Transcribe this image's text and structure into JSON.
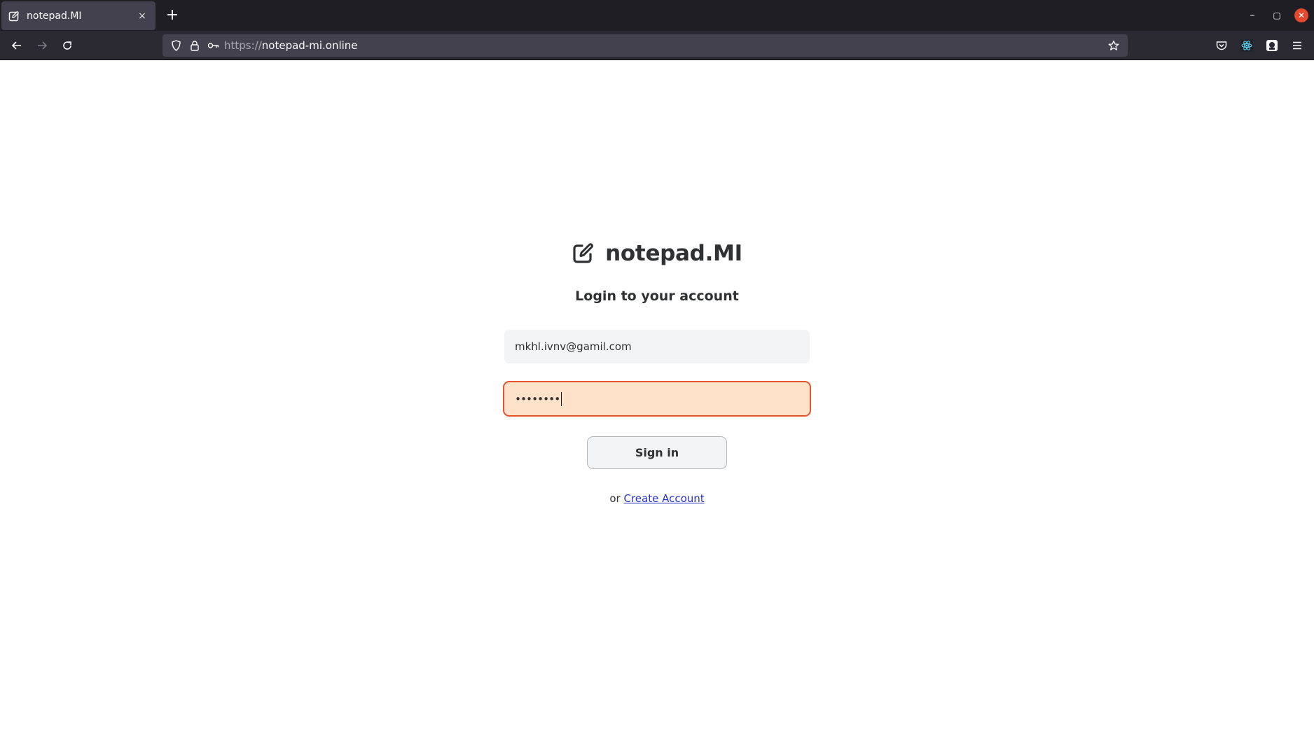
{
  "browser": {
    "tab": {
      "title": "notepad.MI",
      "close_glyph": "×"
    },
    "new_tab_glyph": "+",
    "window_controls": {
      "minimize": "–",
      "maximize": "▢",
      "close": "✕"
    },
    "url": {
      "scheme": "https://",
      "host": "notepad-mi.online"
    },
    "icons": [
      "back-icon",
      "forward-icon",
      "reload-icon",
      "shield-icon",
      "lock-icon",
      "key-icon",
      "star-icon",
      "pocket-icon",
      "react-devtools-icon",
      "extension-icon",
      "menu-icon"
    ]
  },
  "login": {
    "brand_name": "notepad.MI",
    "subtitle": "Login to your account",
    "email_value": "mkhl.ivnv@gamil.com",
    "password_mask": "••••••••",
    "signin_label": "Sign in",
    "alt_prefix": "or",
    "create_account_label": "Create Account"
  },
  "colors": {
    "tabbar_bg": "#1f1e24",
    "navbar_bg": "#2b2a33",
    "password_bg": "#fde2c9",
    "password_border": "#e5542d",
    "text": "#2f3133",
    "link": "#2a33cc"
  }
}
